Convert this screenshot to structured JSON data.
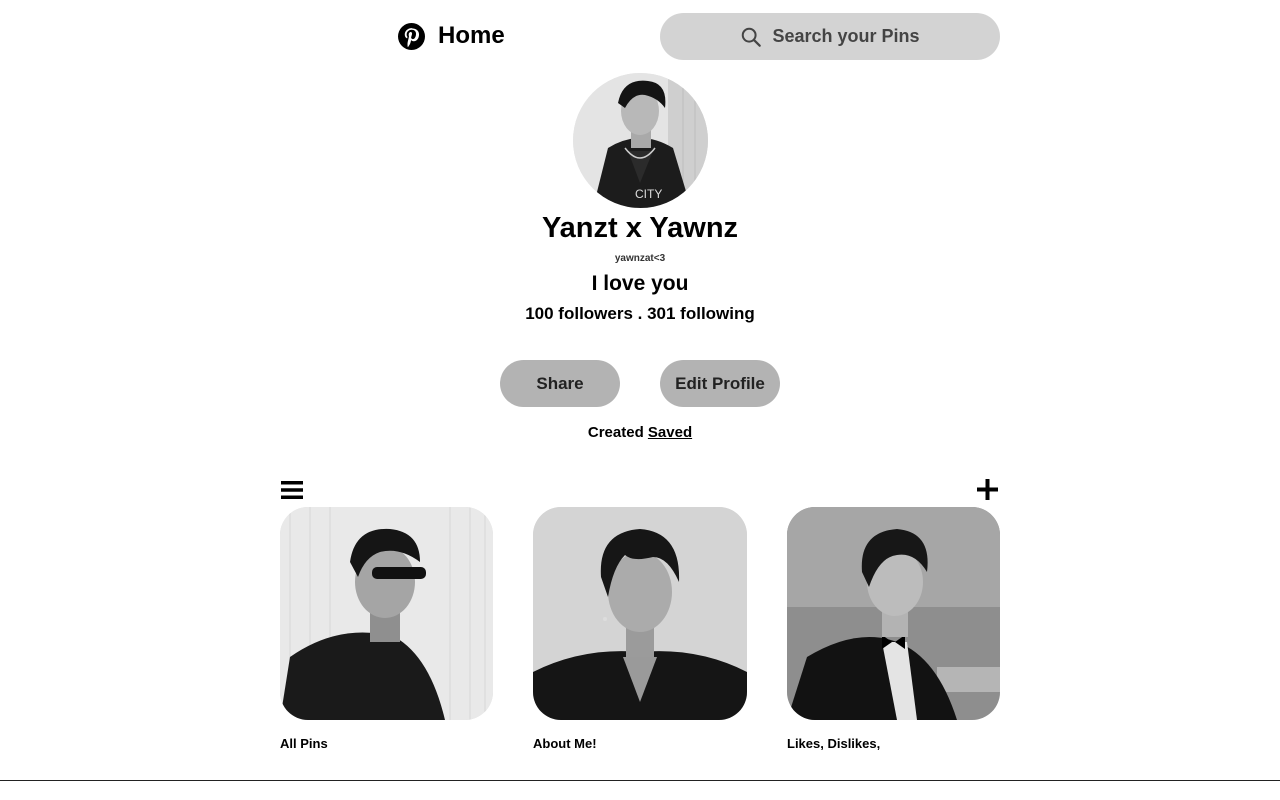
{
  "header": {
    "logo_icon": "pinterest-logo-icon",
    "home_label": "Home",
    "search": {
      "icon": "search-icon",
      "placeholder": "Search your Pins"
    }
  },
  "profile": {
    "avatar": "profile-photo",
    "name": "Yanzt x Yawnz",
    "handle": "yawnzat<3",
    "bio": "I love you",
    "stats": "100 followers . 301 following"
  },
  "actions": {
    "share_label": "Share",
    "edit_label": "Edit Profile"
  },
  "tabs": {
    "created": "Created",
    "saved": "Saved",
    "active": "Saved"
  },
  "toolbar": {
    "menu_icon": "hamburger-menu-icon",
    "add_icon": "plus-icon"
  },
  "boards": [
    {
      "title": "All Pins"
    },
    {
      "title": "About Me!"
    },
    {
      "title": "Likes, Dislikes,"
    }
  ],
  "colors": {
    "search_bg": "#d3d3d3",
    "button_bg": "#b3b3b3",
    "text": "#000000"
  }
}
